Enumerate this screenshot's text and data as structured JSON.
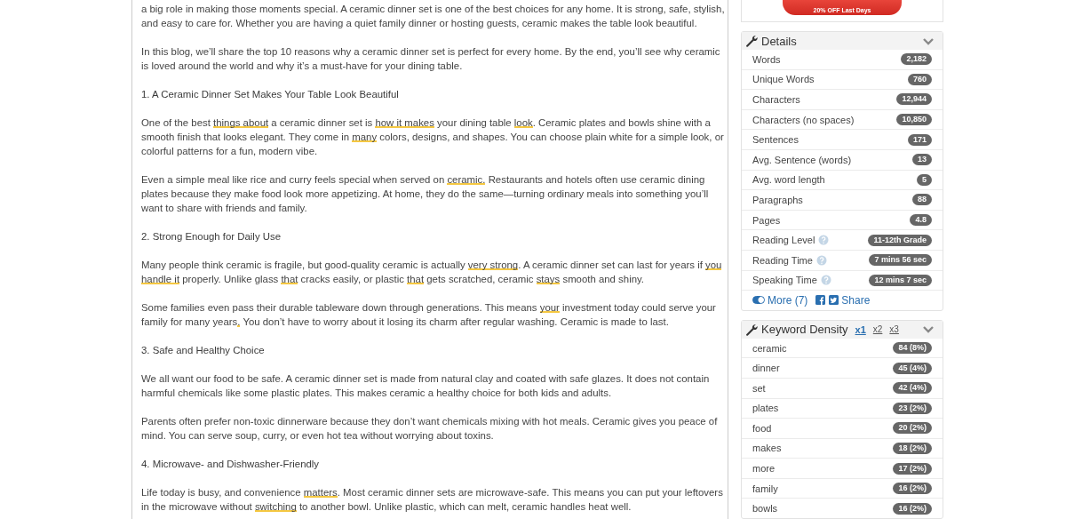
{
  "editor": {
    "blocks": [
      {
        "kind": "paragraph",
        "segments": [
          {
            "text": "a big role in making those moments special. A ceramic dinner set is one of the best choices for any home. It is strong, safe, stylish, and easy to care for. Whether you are having a quiet family dinner or hosting guests, ceramic makes the table look beautiful.",
            "flagged": false
          }
        ]
      },
      {
        "kind": "paragraph",
        "segments": [
          {
            "text": "In this blog, we’ll share the top 10 reasons why a ceramic dinner set is perfect for every home. By the end, you’ll see why ceramic is loved around the world and why it’s a must-have for your dining table.",
            "flagged": false
          }
        ]
      },
      {
        "kind": "heading",
        "segments": [
          {
            "text": "1. A Ceramic Dinner Set Makes Your Table Look Beautiful",
            "flagged": false
          }
        ]
      },
      {
        "kind": "paragraph",
        "segments": [
          {
            "text": "One of the best ",
            "flagged": false
          },
          {
            "text": "things about",
            "flagged": true
          },
          {
            "text": " a ceramic dinner set is ",
            "flagged": false
          },
          {
            "text": "how it makes",
            "flagged": true
          },
          {
            "text": " your dining table ",
            "flagged": false
          },
          {
            "text": "look",
            "flagged": true
          },
          {
            "text": ". Ceramic plates and bowls shine with a smooth finish that looks elegant. They come in ",
            "flagged": false
          },
          {
            "text": "many",
            "flagged": true
          },
          {
            "text": " colors, designs, and shapes. You can choose plain white for a simple look, or colorful patterns for a fun, modern vibe.",
            "flagged": false
          }
        ]
      },
      {
        "kind": "paragraph",
        "segments": [
          {
            "text": "Even a simple meal like rice and curry feels special when served on ",
            "flagged": false
          },
          {
            "text": "ceramic.",
            "flagged": true
          },
          {
            "text": " Restaurants and hotels often use ceramic dining plates because they make food look more appetizing. At home, they do the same—turning ordinary meals into something you’ll want to share with friends and family.",
            "flagged": false
          }
        ]
      },
      {
        "kind": "heading",
        "segments": [
          {
            "text": "2. Strong Enough for Daily Use",
            "flagged": false
          }
        ]
      },
      {
        "kind": "paragraph",
        "segments": [
          {
            "text": "Many people think ceramic is fragile, but good-quality ceramic is actually ",
            "flagged": false
          },
          {
            "text": "very strong",
            "flagged": true
          },
          {
            "text": ". A ceramic dinner set can last for years if ",
            "flagged": false
          },
          {
            "text": "you handle it",
            "flagged": true
          },
          {
            "text": " properly. Unlike glass ",
            "flagged": false
          },
          {
            "text": "that",
            "flagged": true
          },
          {
            "text": " cracks easily, or plastic ",
            "flagged": false
          },
          {
            "text": "that",
            "flagged": true
          },
          {
            "text": " gets scratched, ceramic ",
            "flagged": false
          },
          {
            "text": "stays",
            "flagged": true
          },
          {
            "text": " smooth and shiny.",
            "flagged": false
          }
        ]
      },
      {
        "kind": "paragraph",
        "segments": [
          {
            "text": "Some families even pass their durable tableware down through generations. This means ",
            "flagged": false
          },
          {
            "text": "your",
            "flagged": true
          },
          {
            "text": " investment today could serve your family for many years",
            "flagged": false
          },
          {
            "text": ".",
            "flagged": true
          },
          {
            "text": " You don’t have to worry about it losing its charm after regular washing. Ceramic is made to last.",
            "flagged": false
          }
        ]
      },
      {
        "kind": "heading",
        "segments": [
          {
            "text": "3. Safe and Healthy Choice",
            "flagged": false
          }
        ]
      },
      {
        "kind": "paragraph",
        "segments": [
          {
            "text": "We all want our food to be safe. A ceramic dinner set is made from natural clay and coated with safe glazes. It does not contain harmful chemicals like some plastic plates. This makes ceramic a healthy choice for both kids and adults.",
            "flagged": false
          }
        ]
      },
      {
        "kind": "paragraph",
        "segments": [
          {
            "text": "Parents often prefer non-toxic dinnerware because they don’t want chemicals mixing with hot meals. Ceramic gives you peace of mind. You can serve soup, curry, or even hot tea without worrying about toxins.",
            "flagged": false
          }
        ]
      },
      {
        "kind": "heading",
        "segments": [
          {
            "text": "4. Microwave- and Dishwasher-Friendly",
            "flagged": false
          }
        ]
      },
      {
        "kind": "paragraph",
        "segments": [
          {
            "text": "Life today is busy, and convenience ",
            "flagged": false
          },
          {
            "text": "matters",
            "flagged": true
          },
          {
            "text": ". Most ceramic dinner sets are microwave-safe. This means you can put your leftovers in the microwave without ",
            "flagged": false
          },
          {
            "text": "switching",
            "flagged": true
          },
          {
            "text": " to another bowl. Unlike plastic, which can melt, ceramic handles heat well.",
            "flagged": false
          }
        ]
      }
    ]
  },
  "premium_button": {
    "subtitle": "20% OFF Last Days"
  },
  "details": {
    "title": "Details",
    "expanded": true,
    "rows": [
      {
        "label": "Words",
        "value": "2,182",
        "help": false
      },
      {
        "label": "Unique Words",
        "value": "760",
        "help": false
      },
      {
        "label": "Characters",
        "value": "12,944",
        "help": false
      },
      {
        "label": "Characters (no spaces)",
        "value": "10,850",
        "help": false
      },
      {
        "label": "Sentences",
        "value": "171",
        "help": false
      },
      {
        "label": "Avg. Sentence (words)",
        "value": "13",
        "help": false
      },
      {
        "label": "Avg. word length",
        "value": "5",
        "help": false
      },
      {
        "label": "Paragraphs",
        "value": "88",
        "help": false
      },
      {
        "label": "Pages",
        "value": "4.8",
        "help": false
      },
      {
        "label": "Reading Level",
        "value": "11-12th Grade",
        "help": true
      },
      {
        "label": "Reading Time",
        "value": "7 mins 56 sec",
        "help": true
      },
      {
        "label": "Speaking Time",
        "value": "12 mins 7 sec",
        "help": true
      }
    ],
    "more_link": "More (7)",
    "share_link": "Share"
  },
  "keyword_density": {
    "title": "Keyword Density",
    "expanded": true,
    "tabs": [
      {
        "label": "x1",
        "selected": true
      },
      {
        "label": "x2",
        "selected": false
      },
      {
        "label": "x3",
        "selected": false
      }
    ],
    "rows": [
      {
        "keyword": "ceramic",
        "count": "84 (8%)"
      },
      {
        "keyword": "dinner",
        "count": "45 (4%)"
      },
      {
        "keyword": "set",
        "count": "42 (4%)"
      },
      {
        "keyword": "plates",
        "count": "23 (2%)"
      },
      {
        "keyword": "food",
        "count": "20 (2%)"
      },
      {
        "keyword": "makes",
        "count": "18 (2%)"
      },
      {
        "keyword": "more",
        "count": "17 (2%)"
      },
      {
        "keyword": "family",
        "count": "16 (2%)"
      },
      {
        "keyword": "bowls",
        "count": "16 (2%)"
      }
    ]
  }
}
